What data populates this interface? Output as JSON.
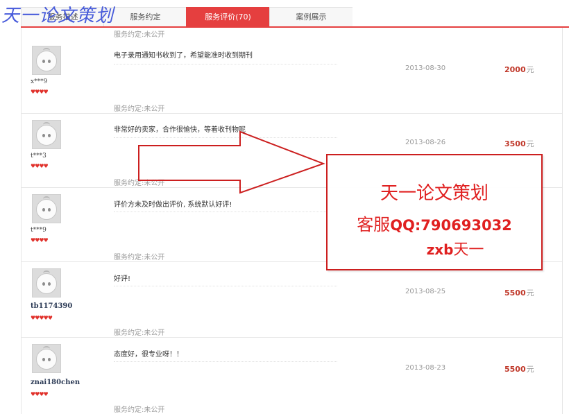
{
  "watermark": "天一论文策划",
  "tabs": [
    {
      "label": "服务描述",
      "active": false
    },
    {
      "label": "服务约定",
      "active": false
    },
    {
      "label": "服务评价(70)",
      "active": true
    },
    {
      "label": "案例展示",
      "active": false
    }
  ],
  "top_note": "服务约定:未公开",
  "reviews": [
    {
      "user": "x***9",
      "rating": "♥♥♥♥",
      "comment": "电子录用通知书收到了，希望能准时收到期刊",
      "date": "2013-08-30",
      "price": "2000",
      "unit": "元",
      "agreement": "服务约定:未公开"
    },
    {
      "user": "t***3",
      "rating": "♥♥♥♥",
      "comment": "非常好的卖家，合作很愉快，等着收刊物呢",
      "date": "2013-08-26",
      "price": "3500",
      "unit": "元",
      "agreement": "服务约定:未公开"
    },
    {
      "user": "t***9",
      "rating": "♥♥♥♥",
      "comment": "评价方未及时做出评价, 系统默认好评!",
      "date": "",
      "price": "",
      "unit": "元",
      "agreement": "服务约定:未公开"
    },
    {
      "user": "tb1174390",
      "rating": "♥♥♥♥♥",
      "comment": "好评!",
      "date": "2013-08-25",
      "price": "5500",
      "unit": "元",
      "agreement": "服务约定:未公开"
    },
    {
      "user": "znai180chen",
      "rating": "♥♥♥♥",
      "comment": "态度好，很专业呀！！",
      "date": "2013-08-23",
      "price": "5500",
      "unit": "元",
      "agreement": "服务约定:未公开"
    }
  ],
  "promo": {
    "line1": "天一论文策划",
    "line2_prefix": "客服",
    "line2_qq": "QQ:790693032",
    "line3_en": "zxb",
    "line3_cn": "天一"
  },
  "colors": {
    "accent": "#e53f3f",
    "price": "#c0392b",
    "promo": "#e02020",
    "watermark": "#3a4fd8"
  }
}
